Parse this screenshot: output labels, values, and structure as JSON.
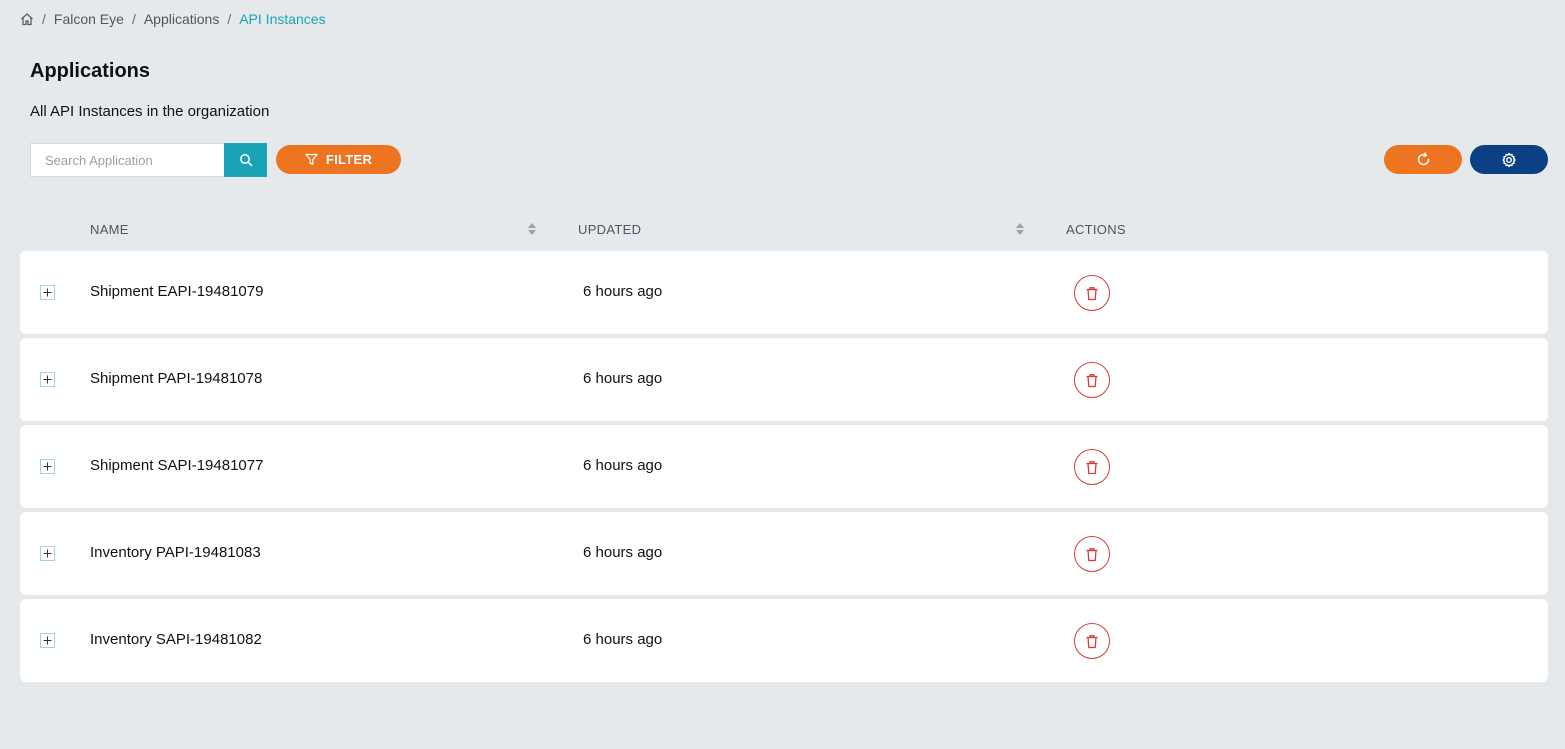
{
  "breadcrumb": {
    "home_icon": "home-icon",
    "items": [
      "Falcon Eye",
      "Applications"
    ],
    "current": "API Instances",
    "separator": "/"
  },
  "header": {
    "title": "Applications",
    "subtitle": "All API Instances in the organization"
  },
  "toolbar": {
    "search_placeholder": "Search Application",
    "search_value": "",
    "filter_label": "FILTER",
    "refresh_icon": "refresh-icon",
    "settings_icon": "gear-icon"
  },
  "table": {
    "columns": [
      "NAME",
      "UPDATED",
      "ACTIONS"
    ],
    "rows": [
      {
        "name": "Shipment EAPI-19481079",
        "updated": "6 hours ago"
      },
      {
        "name": "Shipment PAPI-19481078",
        "updated": "6 hours ago"
      },
      {
        "name": "Shipment SAPI-19481077",
        "updated": "6 hours ago"
      },
      {
        "name": "Inventory PAPI-19481083",
        "updated": "6 hours ago"
      },
      {
        "name": "Inventory SAPI-19481082",
        "updated": "6 hours ago"
      }
    ]
  },
  "colors": {
    "accent_teal": "#1aa3b7",
    "orange": "#ed7421",
    "navy": "#0b4184",
    "danger": "#d93a3a",
    "background": "#e6e9ec"
  }
}
